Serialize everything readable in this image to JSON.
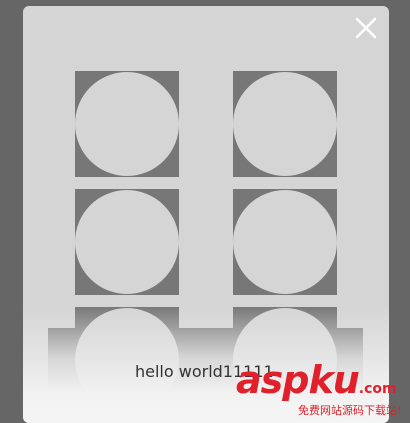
{
  "dialog": {
    "close_icon": "close-icon",
    "message": "hello world11111",
    "overlay_color": "#d5d5d5",
    "backdrop_color": "#666666",
    "tile_color": "#777777"
  },
  "watermark": {
    "logo": "aspku",
    "tld": ".com",
    "tagline": "免费网站源码下载站!",
    "color": "#e0202a"
  }
}
